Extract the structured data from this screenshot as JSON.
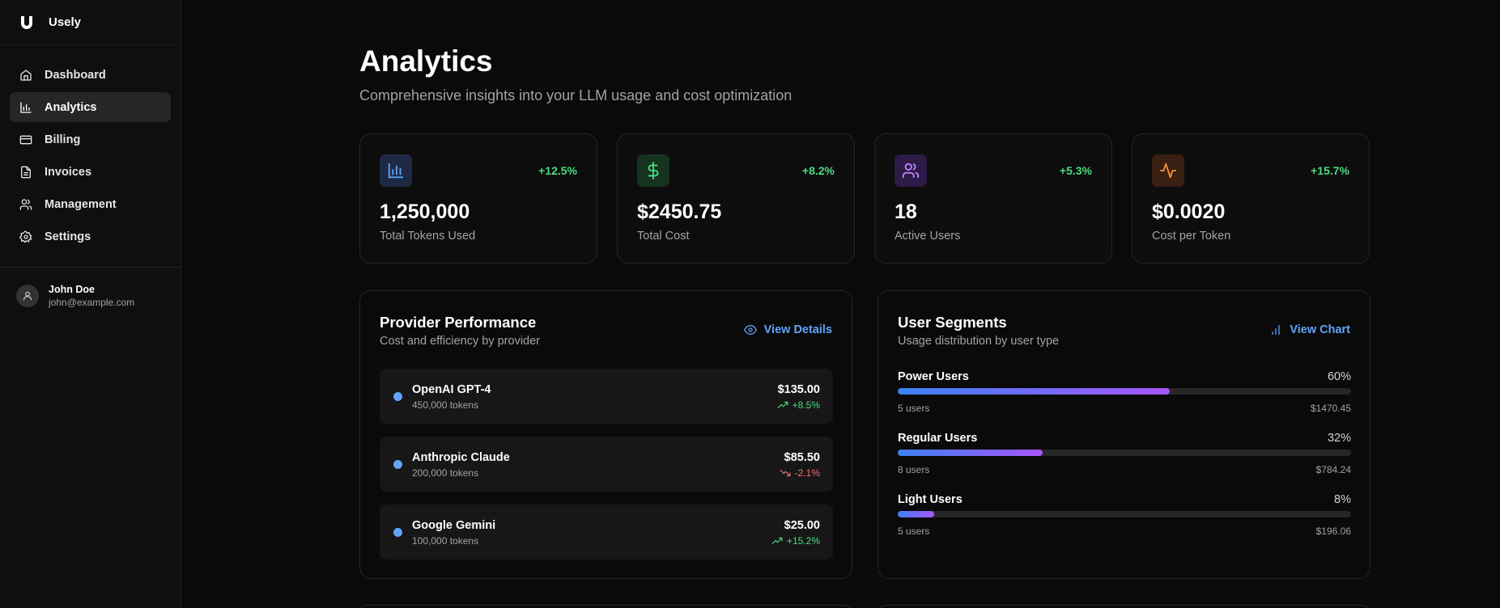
{
  "app": {
    "name": "Usely"
  },
  "sidebar": {
    "items": [
      {
        "label": "Dashboard",
        "icon": "home-icon",
        "active": false
      },
      {
        "label": "Analytics",
        "icon": "bar-chart-icon",
        "active": true
      },
      {
        "label": "Billing",
        "icon": "credit-card-icon",
        "active": false
      },
      {
        "label": "Invoices",
        "icon": "document-icon",
        "active": false
      },
      {
        "label": "Management",
        "icon": "users-icon",
        "active": false
      },
      {
        "label": "Settings",
        "icon": "gear-icon",
        "active": false
      }
    ],
    "user": {
      "name": "John Doe",
      "email": "john@example.com"
    }
  },
  "header": {
    "title": "Analytics",
    "subtitle": "Comprehensive insights into your LLM usage and cost optimization"
  },
  "stats": [
    {
      "icon": "bar-chart-icon",
      "change": "+12.5%",
      "value": "1,250,000",
      "label": "Total Tokens Used"
    },
    {
      "icon": "dollar-icon",
      "change": "+8.2%",
      "value": "$2450.75",
      "label": "Total Cost"
    },
    {
      "icon": "users-icon",
      "change": "+5.3%",
      "value": "18",
      "label": "Active Users"
    },
    {
      "icon": "activity-icon",
      "change": "+15.7%",
      "value": "$0.0020",
      "label": "Cost per Token"
    }
  ],
  "provider_panel": {
    "title": "Provider Performance",
    "subtitle": "Cost and efficiency by provider",
    "action": "View Details",
    "providers": [
      {
        "name": "OpenAI GPT-4",
        "tokens": "450,000 tokens",
        "cost": "$135.00",
        "change": "+8.5%",
        "trend": "up"
      },
      {
        "name": "Anthropic Claude",
        "tokens": "200,000 tokens",
        "cost": "$85.50",
        "change": "-2.1%",
        "trend": "down"
      },
      {
        "name": "Google Gemini",
        "tokens": "100,000 tokens",
        "cost": "$25.00",
        "change": "+15.2%",
        "trend": "up"
      }
    ]
  },
  "segments_panel": {
    "title": "User Segments",
    "subtitle": "Usage distribution by user type",
    "action": "View Chart",
    "segments": [
      {
        "name": "Power Users",
        "percent": "60%",
        "fill": 0.6,
        "users": "5 users",
        "cost": "$1470.45"
      },
      {
        "name": "Regular Users",
        "percent": "32%",
        "fill": 0.32,
        "users": "8 users",
        "cost": "$784.24"
      },
      {
        "name": "Light Users",
        "percent": "8%",
        "fill": 0.08,
        "users": "5 users",
        "cost": "$196.06"
      }
    ]
  },
  "colors": {
    "accent": "#60a5fa",
    "positive": "#4ade80",
    "negative": "#f87171",
    "background": "#0a0a0a"
  }
}
